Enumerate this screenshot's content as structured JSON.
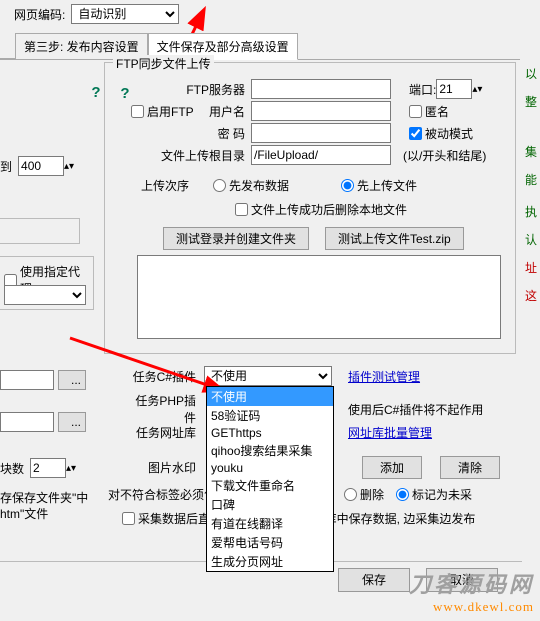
{
  "top": {
    "encoding_label": "网页编码:",
    "encoding_value": "自动识别"
  },
  "tabs": {
    "step3": "第三步: 发布内容设置",
    "filesave": "文件保存及部分高级设置"
  },
  "ftp": {
    "group_title": "FTP同步文件上传",
    "server_label": "FTP服务器",
    "server_value": "",
    "enable_ftp": "启用FTP",
    "user_label": "用户名",
    "user_value": "",
    "pass_label": "密  码",
    "pass_value": "",
    "port_label": "端口:",
    "port_value": "21",
    "anon": "匿名",
    "passive": "被动模式",
    "rootdir_label": "文件上传根目录",
    "rootdir_value": "/FileUpload/",
    "rootdir_hint": "(以/开头和结尾)",
    "order_label": "上传次序",
    "order_pubfirst": "先发布数据",
    "order_upfirst": "先上传文件",
    "del_after": "文件上传成功后删除本地文件",
    "test_login": "测试登录并创建文件夹",
    "test_upload": "测试上传文件Test.zip"
  },
  "left": {
    "to": "到",
    "to_value": "400",
    "use_proxy": "使用指定代理",
    "block_number_label": "块数",
    "block_number": "2",
    "save_hint_a": "存保存文件夹\"中",
    "save_hint_b": "htm\"文件"
  },
  "csharp_label": "任务C#插件",
  "csharp_value": "不使用",
  "php_label": "任务PHP插件",
  "urlstore_label": "任务网址库",
  "watermark_label": "图片水印",
  "mismatch_label": "对不符合标签必须包",
  "collect_publish": "采集数据后直接发布, 不在采集数据库中保存数据, 边采集边发布",
  "plugin_manage": "插件测试管理",
  "plugin_warn": "使用后C#插件将不起作用",
  "urlstore_manage": "网址库批量管理",
  "btn_add": "添加",
  "btn_clear": "清除",
  "rb_delete": "删除",
  "rb_mark": "标记为未采",
  "dd_items": [
    "不使用",
    "58验证码",
    "GEThttps",
    "qihoo搜索结果采集",
    "youku",
    "下载文件重命名",
    "口碑",
    "有道在线翻译",
    "爱帮电话号码",
    "生成分页网址"
  ],
  "btn_save": "保存",
  "btn_cancel": "取消",
  "right_chars": [
    "以",
    "整",
    "集",
    "能",
    "执",
    "认",
    "址",
    "这"
  ],
  "watermark": {
    "line1": "刀客源码网",
    "line2": "www.dkewl.com"
  },
  "dots": "..."
}
